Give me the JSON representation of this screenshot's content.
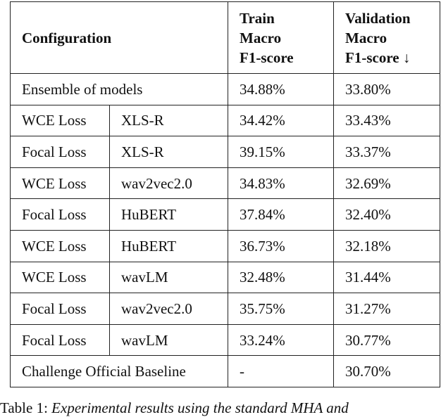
{
  "table": {
    "headers": {
      "configuration": "Configuration",
      "train": [
        "Train",
        "Macro",
        "F1-score"
      ],
      "validation": [
        "Validation",
        "Macro",
        "F1-score ↓"
      ]
    },
    "rows": [
      {
        "config": "Ensemble of models",
        "merged": true,
        "train": "34.88%",
        "validation": "33.80%"
      },
      {
        "loss": "WCE Loss",
        "model": "XLS-R",
        "train": "34.42%",
        "validation": "33.43%"
      },
      {
        "loss": "Focal Loss",
        "model": "XLS-R",
        "train": "39.15%",
        "validation": "33.37%"
      },
      {
        "loss": "WCE Loss",
        "model": "wav2vec2.0",
        "train": "34.83%",
        "validation": "32.69%"
      },
      {
        "loss": "Focal Loss",
        "model": "HuBERT",
        "train": "37.84%",
        "validation": "32.40%"
      },
      {
        "loss": "WCE Loss",
        "model": "HuBERT",
        "train": "36.73%",
        "validation": "32.18%"
      },
      {
        "loss": "WCE Loss",
        "model": "wavLM",
        "train": "32.48%",
        "validation": "31.44%"
      },
      {
        "loss": "Focal Loss",
        "model": "wav2vec2.0",
        "train": "35.75%",
        "validation": "31.27%"
      },
      {
        "loss": "Focal Loss",
        "model": "wavLM",
        "train": "33.24%",
        "validation": "30.77%"
      },
      {
        "config": "Challenge Official Baseline",
        "merged": true,
        "train": "-",
        "validation": "30.70%"
      }
    ]
  },
  "caption": {
    "label": "Table 1:",
    "text": "Experimental results using the standard MHA and"
  }
}
